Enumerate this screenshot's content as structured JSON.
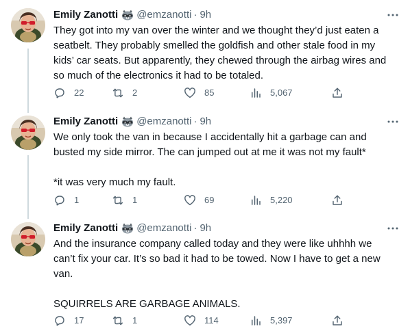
{
  "tweets": [
    {
      "author": "Emily Zanotti",
      "badge_icon": "raccoon-emoji",
      "handle": "@emzanotti",
      "separator": "·",
      "time": "9h",
      "paragraphs": [
        "They got into my van over the winter and we thought they’d just eaten a seatbelt. They probably smelled the goldfish and other stale food in my kids’ car seats. But apparently, they chewed through the airbag wires and so much of the electronics it had to be totaled."
      ],
      "stats": {
        "replies": "22",
        "retweets": "2",
        "likes": "85",
        "views": "5,067"
      }
    },
    {
      "author": "Emily Zanotti",
      "badge_icon": "raccoon-emoji",
      "handle": "@emzanotti",
      "separator": "·",
      "time": "9h",
      "paragraphs": [
        "We only took the van in because I accidentally hit a garbage can and busted my side mirror. The can jumped out at me it was not my fault*",
        "*it was very much my fault."
      ],
      "stats": {
        "replies": "1",
        "retweets": "1",
        "likes": "69",
        "views": "5,220"
      }
    },
    {
      "author": "Emily Zanotti",
      "badge_icon": "raccoon-emoji",
      "handle": "@emzanotti",
      "separator": "·",
      "time": "9h",
      "paragraphs": [
        "And the insurance company called today and they were like uhhhh we can’t fix your car. It’s so bad it had to be towed. Now I have to get a new van.",
        "SQUIRRELS ARE GARBAGE ANIMALS."
      ],
      "stats": {
        "replies": "17",
        "retweets": "1",
        "likes": "114",
        "views": "5,397"
      }
    }
  ],
  "colors": {
    "text": "#0f1419",
    "secondary": "#536471",
    "thread_line": "#cfd9de",
    "background": "#ffffff"
  },
  "icons": {
    "more": "more-horizontal-icon",
    "reply": "reply-icon",
    "retweet": "retweet-icon",
    "like": "heart-icon",
    "views": "analytics-icon",
    "share": "share-icon"
  }
}
